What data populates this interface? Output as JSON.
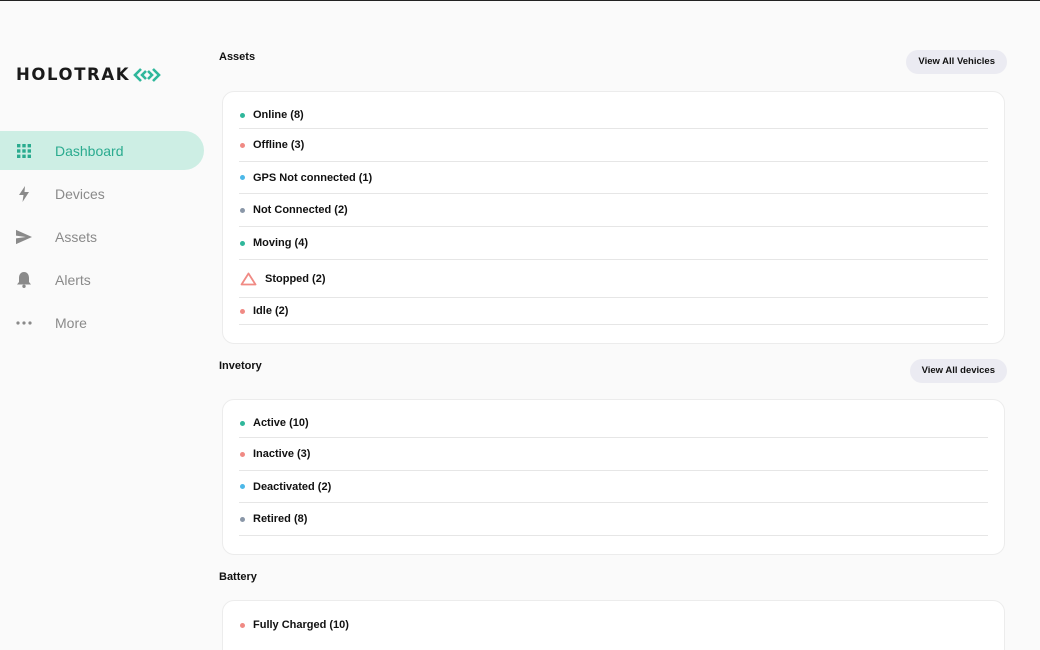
{
  "brand": {
    "name": "HOLOTRAK"
  },
  "sidebar": {
    "items": [
      {
        "label": "Dashboard",
        "icon": "grid-icon"
      },
      {
        "label": "Devices",
        "icon": "bolt-icon"
      },
      {
        "label": "Assets",
        "icon": "send-icon"
      },
      {
        "label": "Alerts",
        "icon": "bell-icon"
      },
      {
        "label": "More",
        "icon": "more-icon"
      }
    ]
  },
  "assets": {
    "title": "Assets",
    "button": "View All Vehicles",
    "rows": [
      {
        "label": "Online (8)",
        "status_color": "#2fb79b"
      },
      {
        "label": "Offline (3)",
        "status_color": "#f08a84"
      },
      {
        "label": "GPS Not connected (1)",
        "status_color": "#4cb8e8"
      },
      {
        "label": "Not Connected (2)",
        "status_color": "#8a97a8"
      },
      {
        "label": "Moving (4)",
        "status_color": "#2fb79b"
      },
      {
        "label": "Stopped (2)",
        "status_color": "#f08a84",
        "icon": "warning-triangle-icon"
      },
      {
        "label": "Idle (2)",
        "status_color": "#f08a84"
      }
    ]
  },
  "inventory": {
    "title": "Invetory",
    "button": "View All devices",
    "rows": [
      {
        "label": "Active (10)",
        "status_color": "#2fb79b"
      },
      {
        "label": "Inactive (3)",
        "status_color": "#f08a84"
      },
      {
        "label": "Deactivated (2)",
        "status_color": "#4cb8e8"
      },
      {
        "label": "Retired (8)",
        "status_color": "#8a97a8"
      }
    ]
  },
  "battery": {
    "title": "Battery",
    "rows": [
      {
        "label": "Fully Charged (10)",
        "status_color": "#f08a84"
      }
    ]
  },
  "colors": {
    "accent": "#2aab8f",
    "active_bg": "#cdeee4"
  }
}
